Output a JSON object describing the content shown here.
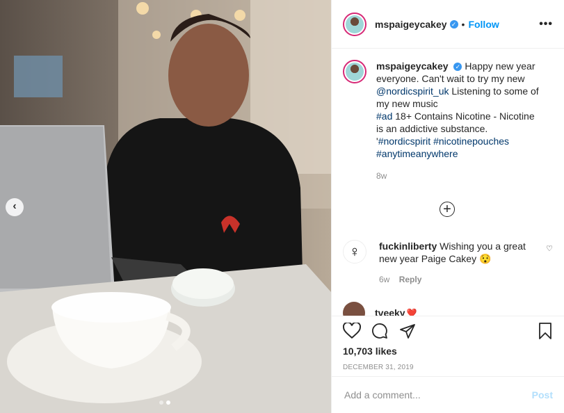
{
  "post": {
    "username": "mspaigeycakey",
    "follow_label": "Follow",
    "separator": "•",
    "more_icon": "more-horizontal-icon",
    "caption_username": "mspaigeycakey",
    "caption_line1": "Happy new year everyone. Can't wait to try my new ",
    "caption_mention": "@nordicspirit_uk",
    "caption_line2": " Listening to some of my new music",
    "caption_tag_ad": "#ad",
    "caption_line3": " 18+ Contains Nicotine - Nicotine is an addictive substance.",
    "caption_line4_prefix": "'",
    "caption_tag1": "#nordicspirit",
    "caption_tag2": "#nicotinepouches",
    "caption_tag3": "#anytimeanywhere",
    "caption_time": "8w",
    "load_more_icon": "plus-circle-icon"
  },
  "comments": [
    {
      "username": "fuckinliberty",
      "text": "Wishing you a great new year Paige Cakey",
      "emoji": "😯",
      "time": "6w",
      "reply_label": "Reply"
    },
    {
      "username": "tveeky",
      "emoji": "❤️"
    }
  ],
  "actions": {
    "likes": "10,703 likes",
    "date": "DECEMBER 31, 2019"
  },
  "add_comment": {
    "placeholder": "Add a comment...",
    "post_label": "Post"
  },
  "carousel": {
    "prev_icon": "chevron-left-icon",
    "total": 2,
    "current": 2
  },
  "colors": {
    "link": "#00376b",
    "follow": "#0095f6",
    "verified": "#3897f0",
    "post_disabled": "#b2dffc"
  }
}
